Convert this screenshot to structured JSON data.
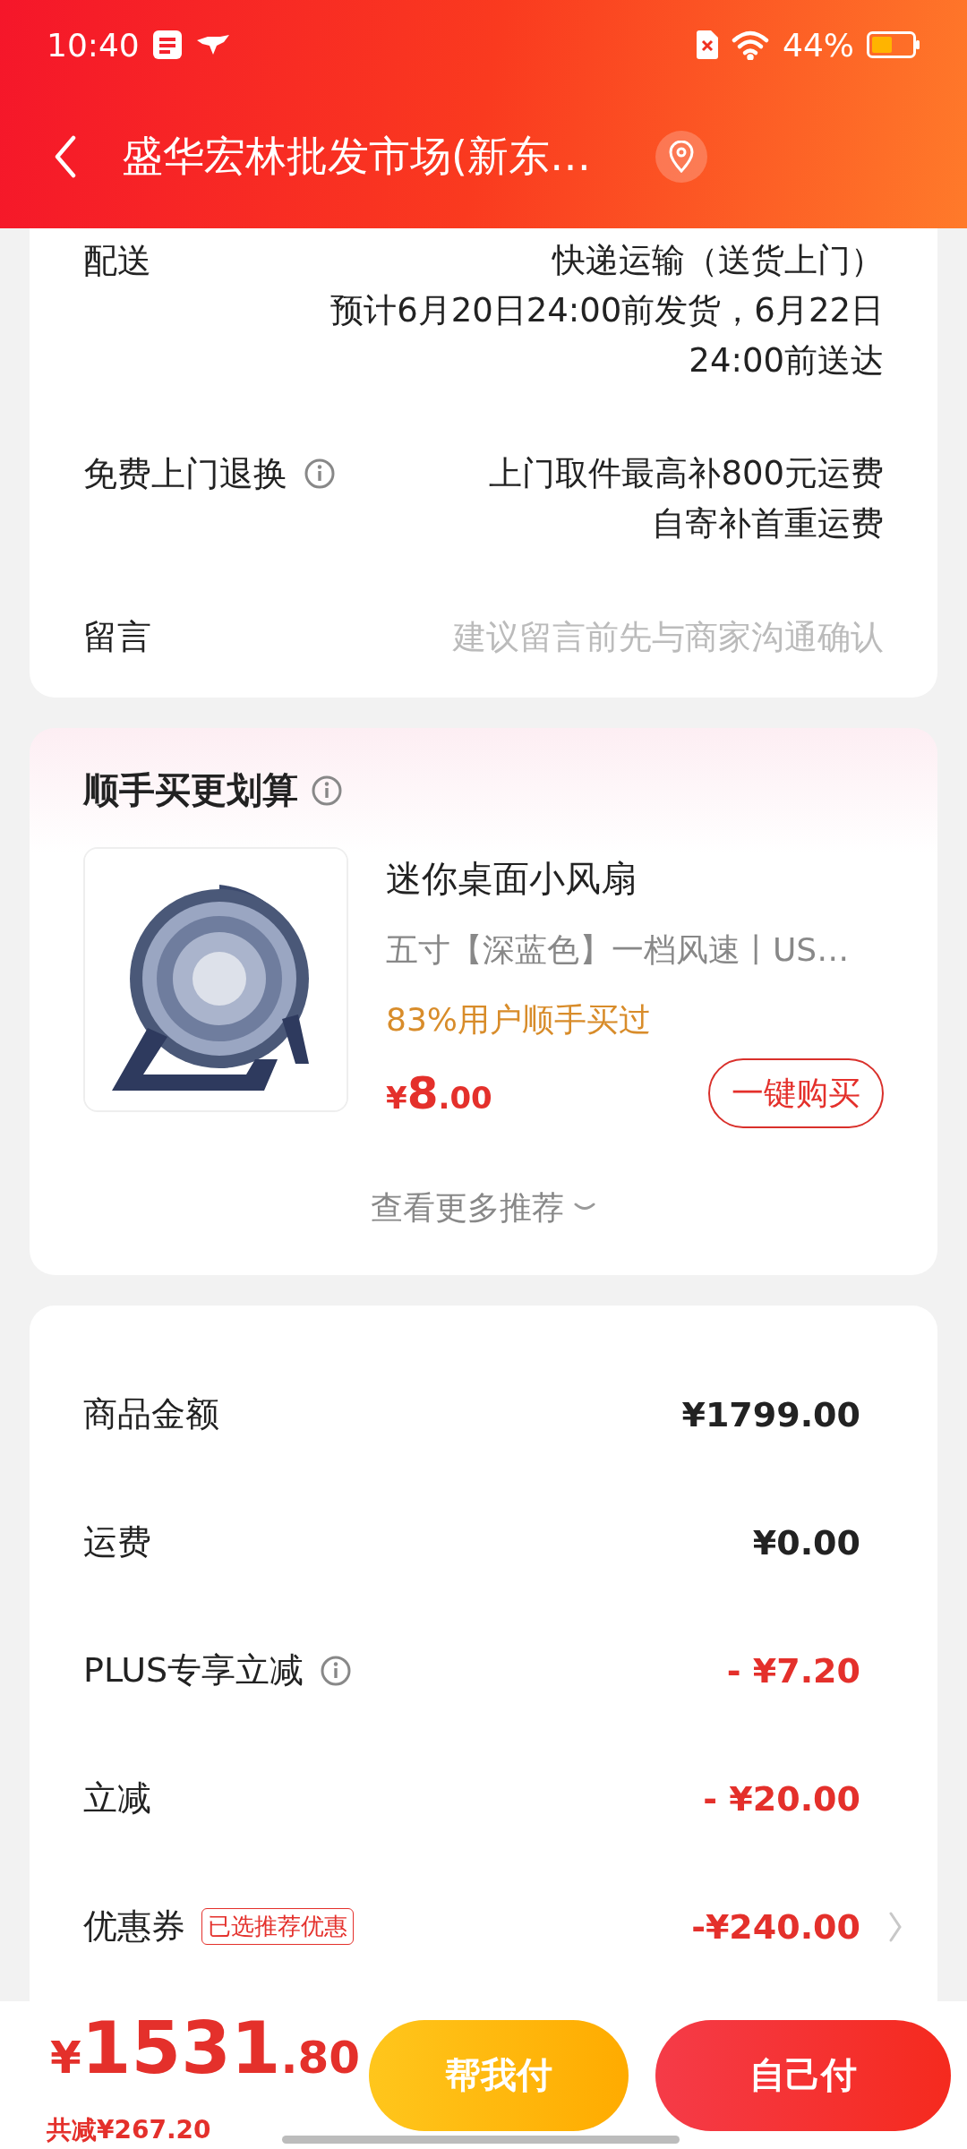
{
  "status_bar": {
    "time": "10:40",
    "battery": "44%"
  },
  "header": {
    "title": "盛华宏林批发市场(新东…"
  },
  "order_info": [
    {
      "kind": "text",
      "label": "配送",
      "info": false,
      "values": [
        "快递运输（送货上门）",
        "预计6月20日24:00前发货，6月22日 24:00前送达"
      ]
    },
    {
      "kind": "text",
      "label": "免费上门退换",
      "info": true,
      "values": [
        "上门取件最高补800元运费",
        "自寄补首重运费"
      ]
    },
    {
      "kind": "input",
      "label": "留言",
      "info": false,
      "placeholder": "建议留言前先与商家沟通确认"
    }
  ],
  "recommendation": {
    "title": "顺手买更划算",
    "product": {
      "name": "迷你桌面小风扇",
      "spec": "五寸【深蓝色】一档风速丨US…",
      "social_proof": "83%用户顺手买过",
      "currency": "¥",
      "price_int": "8",
      "price_dec": ".00",
      "button": "一键购买"
    },
    "more": "查看更多推荐"
  },
  "price_rows": [
    {
      "kind": "amount",
      "label": "商品金额",
      "info": false,
      "value": "¥1799.00",
      "arrow": false
    },
    {
      "kind": "amount",
      "label": "运费",
      "info": false,
      "value": "¥0.00",
      "arrow": false
    },
    {
      "kind": "discount",
      "label": "PLUS专享立减",
      "info": true,
      "value": "- ¥7.20",
      "arrow": false
    },
    {
      "kind": "discount",
      "label": "立减",
      "info": false,
      "value": "- ¥20.00",
      "arrow": false
    },
    {
      "kind": "discount",
      "label": "优惠券",
      "info": false,
      "tag": "已选推荐优惠",
      "value": "-¥240.00",
      "arrow": true
    }
  ],
  "pay_bar": {
    "currency": "¥",
    "total_int": "1531",
    "total_dec": ".80",
    "savings": "共减¥267.20",
    "buttons": [
      {
        "kind": "secondary",
        "label": "帮我付"
      },
      {
        "kind": "primary",
        "label": "自己付"
      }
    ]
  }
}
